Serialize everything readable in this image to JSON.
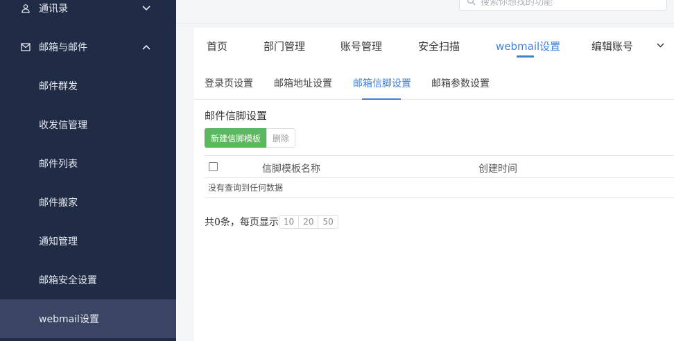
{
  "search": {
    "placeholder": "搜索你想找的功能"
  },
  "sidebar": {
    "contacts": {
      "label": "通讯录"
    },
    "mailbox": {
      "label": "邮箱与邮件"
    },
    "sub_items": [
      {
        "label": "邮件群发"
      },
      {
        "label": "收发信管理"
      },
      {
        "label": "邮件列表"
      },
      {
        "label": "邮件搬家"
      },
      {
        "label": "通知管理"
      },
      {
        "label": "邮箱安全设置"
      },
      {
        "label": "webmail设置",
        "active": true
      }
    ]
  },
  "top_tabs": [
    {
      "label": "首页"
    },
    {
      "label": "部门管理"
    },
    {
      "label": "账号管理"
    },
    {
      "label": "安全扫描"
    },
    {
      "label": "webmail设置",
      "active": true
    },
    {
      "label": "编辑账号"
    }
  ],
  "sub_tabs": [
    {
      "label": "登录页设置"
    },
    {
      "label": "邮箱地址设置"
    },
    {
      "label": "邮箱信脚设置",
      "active": true
    },
    {
      "label": "邮箱参数设置"
    }
  ],
  "section": {
    "title": "邮件信脚设置",
    "new_button": "新建信脚模板",
    "delete_button": "删除"
  },
  "table": {
    "columns": [
      "信脚模板名称",
      "创建时间"
    ],
    "empty_text": "没有查询到任何数据"
  },
  "pager": {
    "summary": "共0条，每页显示",
    "sizes": [
      "10",
      "20",
      "50"
    ]
  },
  "colors": {
    "sidebar_bg": "#202b46",
    "sidebar_active": "#394562",
    "accent": "#3f7fd8",
    "primary_button": "#5cb85c"
  }
}
